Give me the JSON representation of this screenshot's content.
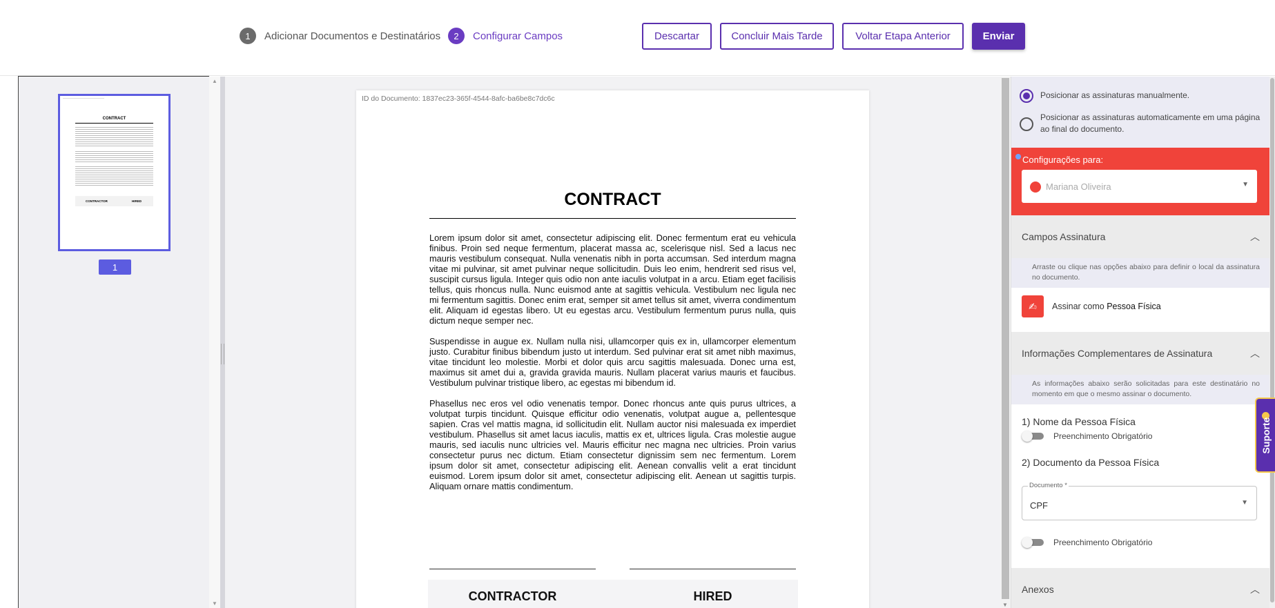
{
  "header": {
    "steps": [
      {
        "number": "1",
        "label": "Adicionar Documentos e Destinatários"
      },
      {
        "number": "2",
        "label": "Configurar Campos"
      }
    ],
    "buttons": {
      "discard": "Descartar",
      "finish_later": "Concluir Mais Tarde",
      "previous_step": "Voltar Etapa Anterior",
      "send": "Enviar"
    }
  },
  "thumbnails": {
    "pages": [
      {
        "page_number": "1"
      }
    ],
    "mini_title": "CONTRACT",
    "mini_contractor": "CONTRACTOR",
    "mini_hired": "HIRED"
  },
  "document": {
    "id_label": "ID do Documento: 1837ec23-365f-4544-8afc-ba6be8c7dc6c",
    "title": "CONTRACT",
    "paragraphs": [
      "Lorem ipsum dolor sit amet, consectetur adipiscing elit. Donec fermentum erat eu vehicula finibus. Proin sed neque fermentum, placerat massa ac, scelerisque nisl. Sed a lacus nec mauris vestibulum consequat. Nulla venenatis nibh in porta accumsan. Sed interdum magna vitae mi pulvinar, sit amet pulvinar neque sollicitudin. Duis leo enim, hendrerit sed risus vel, suscipit cursus ligula. Integer quis odio non ante iaculis volutpat in a arcu. Etiam eget facilisis tellus, quis rhoncus nulla. Nunc euismod ante at sagittis vehicula. Vestibulum nec ligula nec mi fermentum sagittis. Donec enim erat, semper sit amet tellus sit amet, viverra condimentum elit. Aliquam id egestas libero. Ut eu egestas arcu. Vestibulum fermentum purus nulla, quis dictum neque semper nec.",
      "Suspendisse in augue ex. Nullam nulla nisi, ullamcorper quis ex in, ullamcorper elementum justo. Curabitur finibus bibendum justo ut interdum. Sed pulvinar erat sit amet nibh maximus, vitae tincidunt leo molestie. Morbi et dolor quis arcu sagittis malesuada. Donec urna est, maximus sit amet dui a, gravida gravida mauris. Nullam placerat varius mauris et faucibus. Vestibulum pulvinar tristique libero, ac egestas mi bibendum id.",
      "Phasellus nec eros vel odio venenatis tempor. Donec rhoncus ante quis purus ultrices, a volutpat turpis tincidunt. Quisque efficitur odio venenatis, volutpat augue a, pellentesque sapien. Cras vel mattis magna, id sollicitudin elit. Nullam auctor nisi malesuada ex imperdiet vestibulum. Phasellus sit amet lacus iaculis, mattis ex et, ultrices ligula. Cras molestie augue mauris, sed iaculis nunc ultricies vel. Mauris efficitur nec magna nec ultricies. Proin varius consectetur purus nec dictum. Etiam consectetur dignissim sem nec fermentum. Lorem ipsum dolor sit amet, consectetur adipiscing elit. Aenean convallis velit a erat tincidunt euismod. Lorem ipsum dolor sit amet, consectetur adipiscing elit. Aenean ut sagittis turpis. Aliquam ornare mattis condimentum."
    ],
    "signatures": {
      "left": "CONTRACTOR",
      "right": "HIRED"
    }
  },
  "sidebar": {
    "positioning": {
      "manual": "Posicionar as assinaturas manualmente.",
      "automatic": "Posicionar as assinaturas automaticamente em uma página ao final do documento.",
      "selected": "manual"
    },
    "config": {
      "label": "Configurações para:",
      "signer": "Mariana Oliveira",
      "signer_color": "#f0433a"
    },
    "signature_fields": {
      "title": "Campos Assinatura",
      "info": "Arraste ou clique nas opções abaixo para definir o local da assinatura no documento.",
      "sign_as_prefix": "Assinar como",
      "sign_as_type": "Pessoa Física"
    },
    "complementary": {
      "title": "Informações Complementares de Assinatura",
      "info": "As informações abaixo serão solicitadas para este destinatário no momento em que o mesmo assinar o documento.",
      "field1_title": "1) Nome da Pessoa Física",
      "field1_toggle": "Preenchimento Obrigatório",
      "field2_title": "2) Documento da Pessoa Física",
      "document_label": "Documento *",
      "document_value": "CPF",
      "field2_toggle": "Preenchimento Obrigatório"
    },
    "attachments": {
      "title": "Anexos"
    }
  },
  "support": {
    "label": "Suporte"
  },
  "colors": {
    "primary": "#5a2fae",
    "accent_red": "#f0433a",
    "thumb_highlight": "#5c5ce0"
  }
}
